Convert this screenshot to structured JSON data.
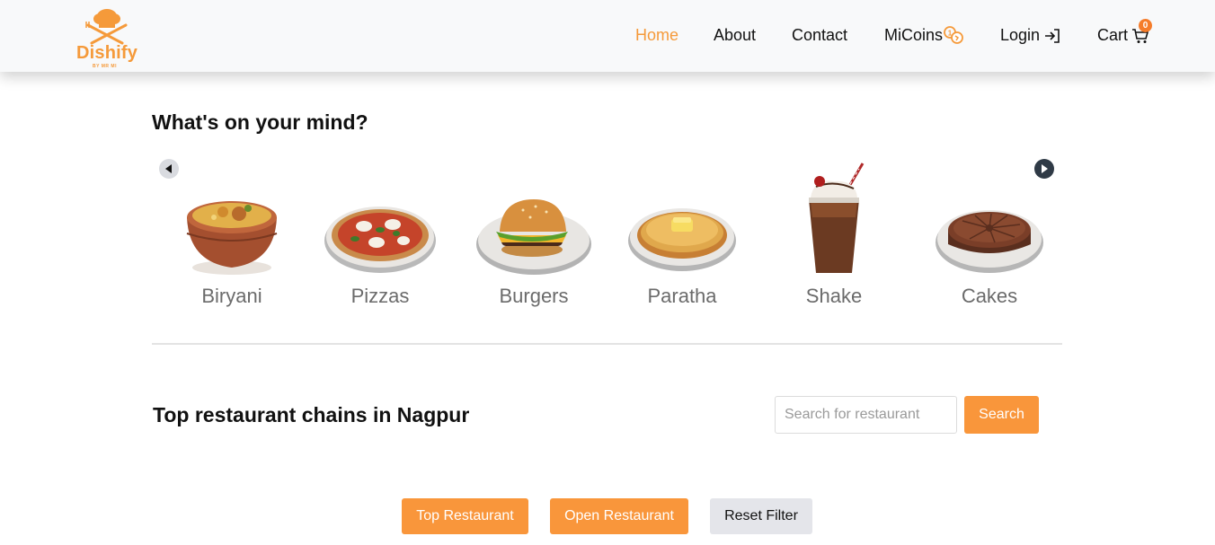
{
  "brand": {
    "name": "Dishify",
    "tagline": "BY MR MI",
    "color": "#f59a3a"
  },
  "nav": {
    "home": "Home",
    "about": "About",
    "contact": "Contact",
    "micoins": "MiCoins",
    "login": "Login",
    "cart": "Cart",
    "cart_count": "0"
  },
  "mind": {
    "title": "What's on your mind?",
    "categories": [
      {
        "label": "Biryani",
        "icon": "biryani-icon"
      },
      {
        "label": "Pizzas",
        "icon": "pizza-icon"
      },
      {
        "label": "Burgers",
        "icon": "burger-icon"
      },
      {
        "label": "Paratha",
        "icon": "paratha-icon"
      },
      {
        "label": "Shake",
        "icon": "shake-icon"
      },
      {
        "label": "Cakes",
        "icon": "cake-icon"
      }
    ]
  },
  "restaurants": {
    "title": "Top restaurant chains in Nagpur",
    "search_placeholder": "Search for restaurant",
    "search_value": "",
    "search_button": "Search"
  },
  "filters": {
    "top": "Top Restaurant",
    "open": "Open Restaurant",
    "reset": "Reset Filter"
  },
  "colors": {
    "accent": "#f9963b",
    "badge": "#f57c2a"
  }
}
